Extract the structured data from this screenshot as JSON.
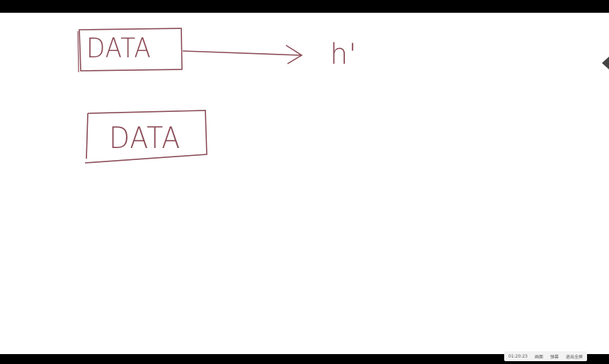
{
  "board": {
    "box1_label": "DATA",
    "box2_label": "DATA",
    "arrow_target": "h'"
  },
  "colors": {
    "ink": "#8a4a55",
    "background": "#ffffff",
    "frame": "#000000"
  },
  "status_bar": {
    "time": "01:20:23",
    "btn1": "画面",
    "btn2": "弹幕",
    "btn3": "退出全屏"
  }
}
